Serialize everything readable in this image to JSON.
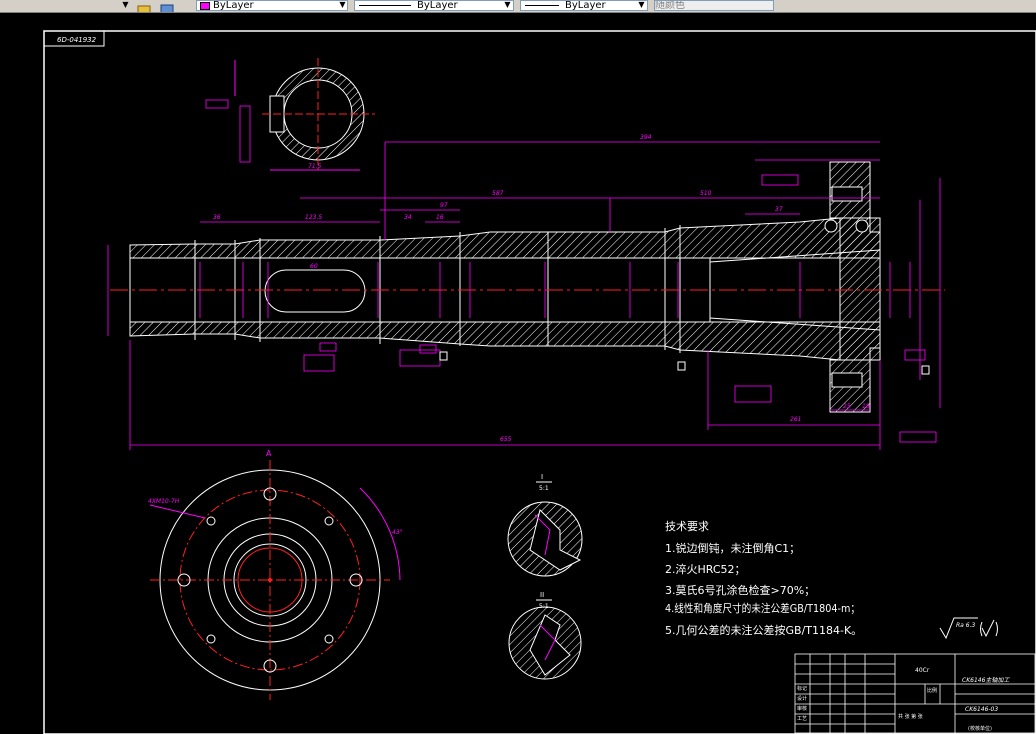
{
  "toolbar": {
    "layer_value": "ByLayer",
    "linetype_value": "ByLayer",
    "lineweight_value": "ByLayer",
    "color_value": "随颜色"
  },
  "drawing": {
    "corner_tag": "6D-041932",
    "technical_requirements": {
      "heading": "技术要求",
      "items": [
        "1.锐边倒钝，未注倒角C1；",
        "2.淬火HRC52；",
        "3.莫氏6号孔涂色检查>70%；",
        "4.线性和角度尺寸的未注公差GB/T1804-m；",
        "5.几何公差的未注公差按GB/T1184-K。"
      ]
    },
    "roughness_symbol": "Ra 6.3",
    "view_label_a": "A",
    "section_label_1": "I",
    "section_scale_1": "5:1",
    "section_label_2": "II",
    "section_scale_2": "5:1",
    "dims": {
      "overall_length": "655",
      "length_right": "261",
      "length_394": "394",
      "length_587": "587",
      "length_510": "510",
      "length_36": "36",
      "length_123": "123.5",
      "length_34": "34",
      "length_97": "97",
      "length_16": "16",
      "length_37": "37",
      "length_60": "60",
      "angle_43": "43°",
      "holes_note": "4XM10-7H",
      "section_dim": "71.5",
      "flange_25": "25",
      "flange_18": "18"
    },
    "title_block": {
      "material": "40Cr",
      "part_name": "CK6146主轴加工",
      "drawing_no": "CK6146-03",
      "row_labels": [
        "标记",
        "设计",
        "审核",
        "工艺"
      ],
      "scale_label": "比例",
      "sheet_label": "共 张 第 张",
      "note": "(校核单位)"
    }
  }
}
